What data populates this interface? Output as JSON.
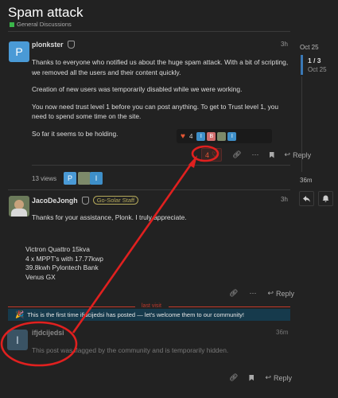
{
  "topic": {
    "title": "Spam attack",
    "category": "General Discussions",
    "category_color": "#3ab54a"
  },
  "timeline": {
    "start_date": "Oct 25",
    "position": "1 / 3",
    "position_date": "Oct 25",
    "end_label": "36m"
  },
  "posts": [
    {
      "avatar_letter": "P",
      "avatar_color": "#4a9ad6",
      "username": "plonkster",
      "date": "3h",
      "paragraphs": [
        "Thanks to everyone who notified us about the huge spam attack. With a bit of scripting, we removed all the users and their content quickly.",
        "Creation of new users was temporarily disabled while we were working.",
        "You now need trust level 1 before you can post anything. To get to Trust level 1, you need to spend some time on the site.",
        "So far it seems to be holding."
      ],
      "reactions_count": "4",
      "reaction_avatars": [
        "I",
        "B",
        "",
        "I"
      ],
      "like_count": "4",
      "reply_label": "Reply",
      "views": "13 views",
      "participant_letters": [
        "P",
        "I"
      ]
    },
    {
      "username": "JacoDeJongh",
      "flair": "Go-Solar Staff",
      "date": "3h",
      "text": "Thanks for your assistance, Plonk. I truly appreciate.",
      "signature": [
        "Victron Quattro 15kva",
        "4 x MPPT's with 17.77kwp",
        "39.8kwh Pylontech Bank",
        "Venus GX"
      ],
      "reply_label": "Reply"
    },
    {
      "avatar_letter": "I",
      "username": "ifjdcijedsi",
      "date": "36m",
      "text": "This post was flagged by the community and is temporarily hidden.",
      "reply_label": "Reply"
    }
  ],
  "last_visit_label": "last visit",
  "welcome_text": "This is the first time ifjdcijedsi has posted — let's welcome them to our community!",
  "colors": {
    "accent_blue": "#3a78b5",
    "like_red": "#e45735",
    "annotation_red": "#e0201f",
    "welcome_bg": "#163a4c"
  }
}
